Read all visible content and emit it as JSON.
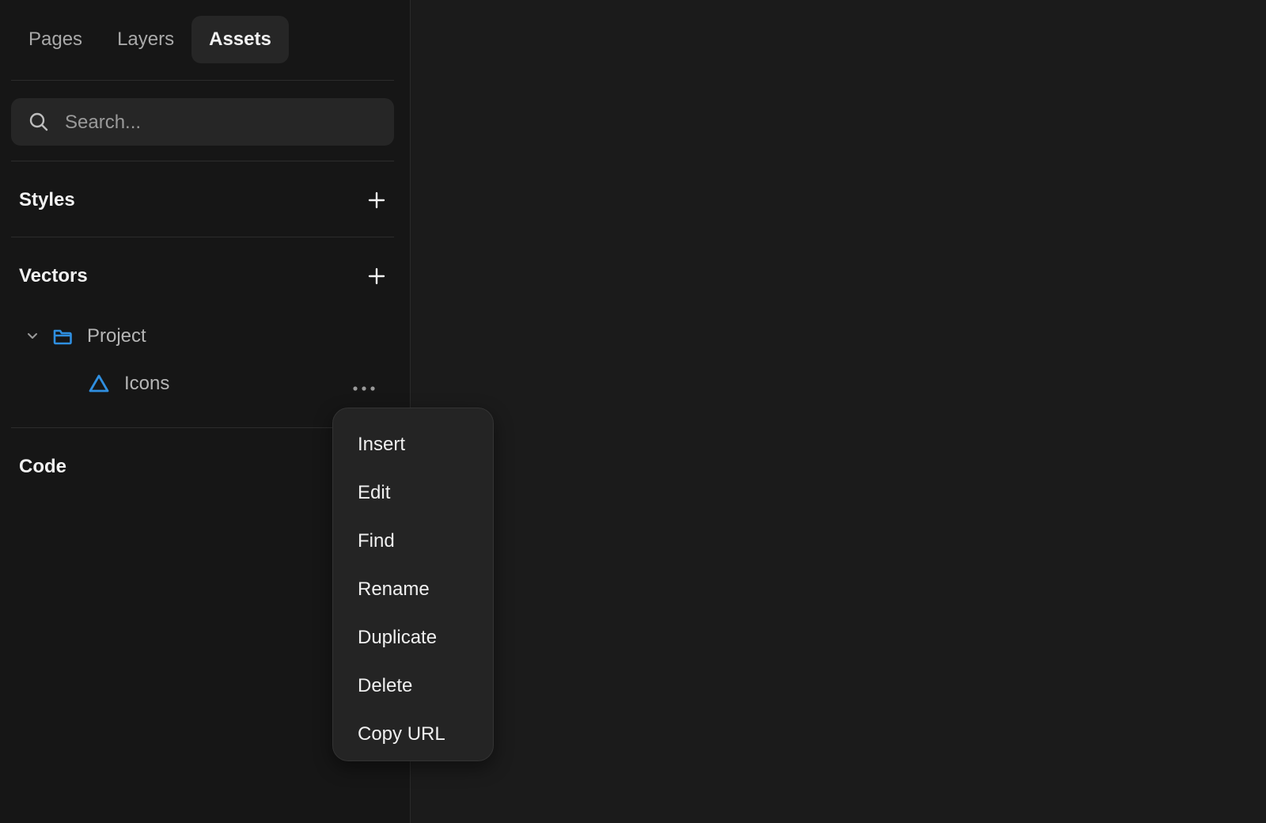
{
  "tabs": [
    {
      "label": "Pages"
    },
    {
      "label": "Layers"
    },
    {
      "label": "Assets"
    }
  ],
  "active_tab": "Assets",
  "search": {
    "placeholder": "Search..."
  },
  "sections": {
    "styles": {
      "title": "Styles"
    },
    "vectors": {
      "title": "Vectors"
    },
    "code": {
      "title": "Code"
    }
  },
  "tree": {
    "project": {
      "label": "Project",
      "icon": "folder-icon",
      "expanded": true
    },
    "icons": {
      "label": "Icons",
      "icon": "vector-set-icon"
    }
  },
  "context_menu": {
    "items": [
      {
        "label": "Insert"
      },
      {
        "label": "Edit"
      },
      {
        "label": "Find"
      },
      {
        "label": "Rename"
      },
      {
        "label": "Duplicate"
      },
      {
        "label": "Delete"
      },
      {
        "label": "Copy URL"
      }
    ]
  },
  "colors": {
    "accent": "#2f8fe0",
    "background": "#1a1a1a",
    "sidebar": "#161616",
    "menu": "#242424"
  }
}
